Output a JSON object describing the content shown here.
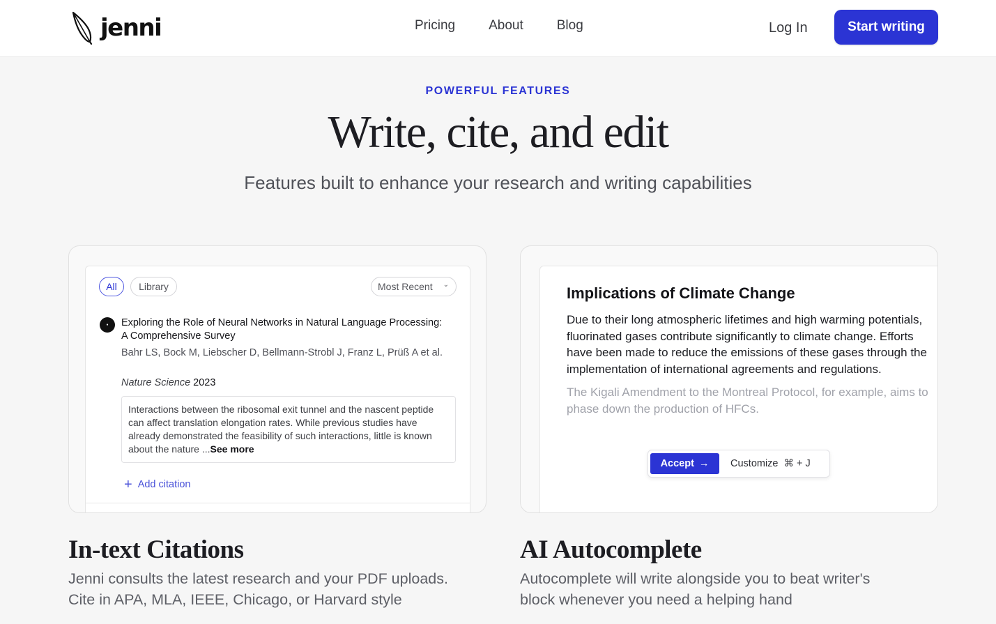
{
  "header": {
    "logo_text": "jenni",
    "nav": [
      "Pricing",
      "About",
      "Blog"
    ],
    "login_label": "Log In",
    "cta_label": "Start writing"
  },
  "hero": {
    "eyebrow": "POWERFUL FEATURES",
    "title": "Write, cite, and edit",
    "subtitle": "Features built to enhance your research and writing capabilities"
  },
  "citations_card": {
    "filter_all": "All",
    "filter_library": "Library",
    "sort_label": "Most Recent",
    "paper": {
      "title": "Exploring the Role of Neural Networks in Natural Language Processing: A Comprehensive Survey",
      "authors": "Bahr LS, Bock M, Liebscher D, Bellmann-Strobl J, Franz L, Prüß A et al.",
      "journal": "Nature Science",
      "year": "2023",
      "abstract": "Interactions between the ribosomal exit tunnel and the nascent peptide can affect translation elongation rates. While previous studies have already demonstrated the feasibility of such interactions, little is known about the nature ...",
      "see_more": "See more"
    },
    "add_citation": "Add citation"
  },
  "autocomplete_card": {
    "heading": "Implications of Climate Change",
    "body_lines": [
      "Due to their long atmospheric lifetimes and high warming potentials,",
      "fluorinated gases contribute significantly to climate change. Efforts",
      "have been made to reduce the emissions of these gases through the",
      "implementation of international agreements and regulations."
    ],
    "suggestion_lines": [
      "The Kigali Amendment to the Montreal Protocol, for example, aims to",
      "phase down the production of HFCs."
    ],
    "accept_label": "Accept",
    "customize_label": "Customize",
    "shortcut": "⌘ + J"
  },
  "features": [
    {
      "title": "In-text Citations",
      "desc_lines": [
        "Jenni consults the latest research and your PDF uploads.",
        "Cite in APA, MLA, IEEE, Chicago, or Harvard style"
      ]
    },
    {
      "title": "AI Autocomplete",
      "desc_lines": [
        "Autocomplete will write alongside you to beat writer's",
        "block whenever you need a helping hand"
      ]
    }
  ],
  "colors": {
    "brand": "#2b34d4",
    "background": "#f6f6f6"
  },
  "icons": [
    "feather-logo-icon",
    "chevron-down-icon",
    "plus-icon",
    "arrow-right-icon",
    "journal-icon"
  ]
}
